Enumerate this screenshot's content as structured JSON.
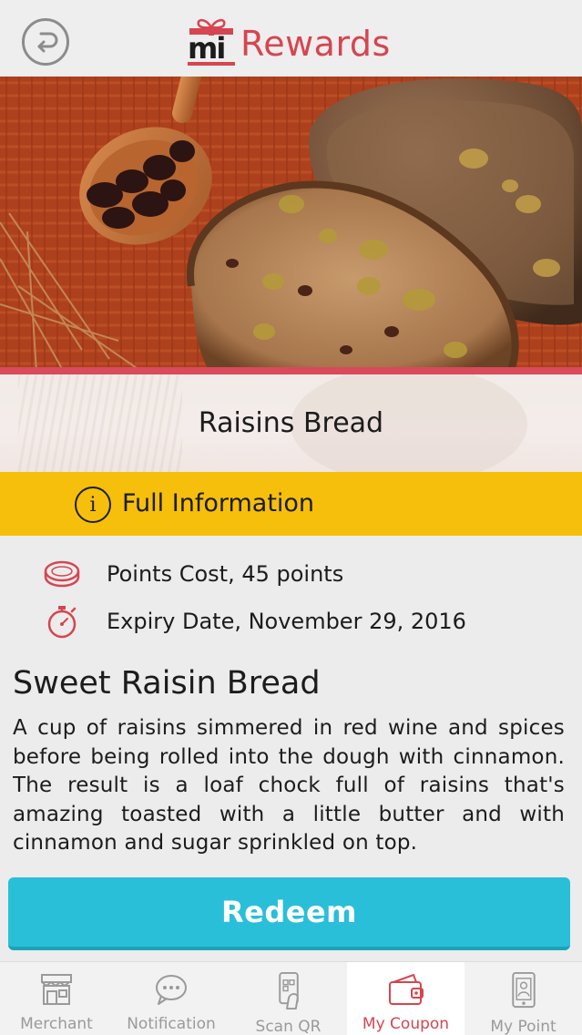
{
  "header": {
    "app_title": "Rewards",
    "logo_mark": "mi"
  },
  "coupon": {
    "name": "Raisins Bread",
    "info_label": "Full Information",
    "points_cost": "Points Cost, 45 points",
    "expiry": "Expiry Date, November 29, 2016",
    "description_title": "Sweet Raisin Bread",
    "description": "A cup of raisins simmered in red wine and spices before being rolled into the dough with cinnamon. The result is a loaf chock full of raisins that's amazing toasted with a little butter and with cinnamon and sugar sprinkled on top."
  },
  "actions": {
    "redeem_label": "Redeem"
  },
  "tabs": [
    {
      "label": "Merchant",
      "icon": "storefront-icon",
      "active": false
    },
    {
      "label": "Notification",
      "icon": "chat-bubble-icon",
      "active": false
    },
    {
      "label": "Scan QR",
      "icon": "phone-scan-icon",
      "active": false
    },
    {
      "label": "My Coupon",
      "icon": "wallet-icon",
      "active": true
    },
    {
      "label": "My Point",
      "icon": "phone-profile-icon",
      "active": false
    }
  ],
  "colors": {
    "accent": "#d64550",
    "info_banner": "#f5bf0b",
    "redeem": "#29bfd9"
  }
}
